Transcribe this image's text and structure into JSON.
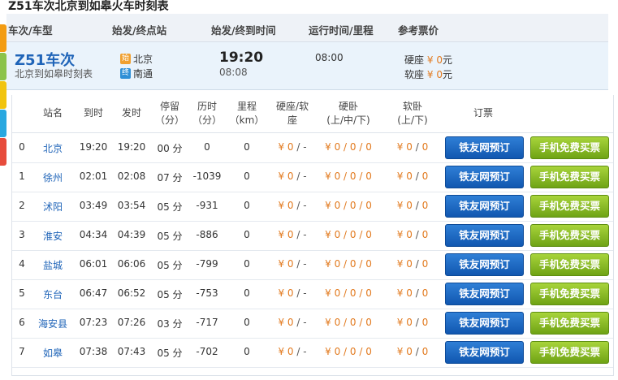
{
  "page_title": "Z51车次北京到如皋火车时刻表",
  "header": {
    "col_train": "车次/车型",
    "col_stations": "始发/终点站",
    "col_times": "始发/终到时间",
    "col_runtime": "运行时间/里程",
    "col_fare": "参考票价"
  },
  "summary": {
    "train_no": "Z51车次",
    "subtitle": "北京到如皋时刻表",
    "start_icon": "始",
    "start_station": "北京",
    "end_icon": "终",
    "end_station": "南通",
    "depart_time": "19:20",
    "arrive_time": "08:08",
    "run_time": "08:00",
    "fares": [
      {
        "label": "硬座",
        "currency": "¥",
        "value": "0",
        "unit": "元"
      },
      {
        "label": "软座",
        "currency": "¥",
        "value": "0",
        "unit": "元"
      }
    ]
  },
  "table": {
    "headers": {
      "station": "站名",
      "arrive": "到时",
      "depart": "发时",
      "stop_1": "停留",
      "stop_2": "（分）",
      "elapsed_1": "历时",
      "elapsed_2": "（分）",
      "mileage_1": "里程",
      "mileage_2": "（km）",
      "seat_1": "硬座/软",
      "seat_2": "座",
      "hard_sleeper_1": "硬卧",
      "hard_sleeper_2": "(上/中/下)",
      "soft_sleeper_1": "软卧",
      "soft_sleeper_2": "(上/下)",
      "booking": "订票"
    },
    "buttons": {
      "web": "铁友网预订",
      "mobile": "手机免费买票"
    },
    "rows": [
      {
        "idx": "0",
        "station": "北京",
        "arrive": "19:20",
        "depart": "19:20",
        "stop": "00 分",
        "elapsed": "0",
        "mileage": "0",
        "seat": [
          "¥",
          "0",
          "/ -"
        ],
        "hard": [
          "¥",
          "0",
          "/ 0 /",
          "0"
        ],
        "soft": [
          "¥",
          "0",
          "/",
          "0"
        ]
      },
      {
        "idx": "1",
        "station": "徐州",
        "arrive": "02:01",
        "depart": "02:08",
        "stop": "07 分",
        "elapsed": "-1039",
        "mileage": "0",
        "seat": [
          "¥",
          "0",
          "/ -"
        ],
        "hard": [
          "¥",
          "0",
          "/ 0 /",
          "0"
        ],
        "soft": [
          "¥",
          "0",
          "/",
          "0"
        ]
      },
      {
        "idx": "2",
        "station": "沭阳",
        "arrive": "03:49",
        "depart": "03:54",
        "stop": "05 分",
        "elapsed": "-931",
        "mileage": "0",
        "seat": [
          "¥",
          "0",
          "/ -"
        ],
        "hard": [
          "¥",
          "0",
          "/ 0 /",
          "0"
        ],
        "soft": [
          "¥",
          "0",
          "/",
          "0"
        ]
      },
      {
        "idx": "3",
        "station": "淮安",
        "arrive": "04:34",
        "depart": "04:39",
        "stop": "05 分",
        "elapsed": "-886",
        "mileage": "0",
        "seat": [
          "¥",
          "0",
          "/ -"
        ],
        "hard": [
          "¥",
          "0",
          "/ 0 /",
          "0"
        ],
        "soft": [
          "¥",
          "0",
          "/",
          "0"
        ]
      },
      {
        "idx": "4",
        "station": "盐城",
        "arrive": "06:01",
        "depart": "06:06",
        "stop": "05 分",
        "elapsed": "-799",
        "mileage": "0",
        "seat": [
          "¥",
          "0",
          "/ -"
        ],
        "hard": [
          "¥",
          "0",
          "/ 0 /",
          "0"
        ],
        "soft": [
          "¥",
          "0",
          "/",
          "0"
        ]
      },
      {
        "idx": "5",
        "station": "东台",
        "arrive": "06:47",
        "depart": "06:52",
        "stop": "05 分",
        "elapsed": "-753",
        "mileage": "0",
        "seat": [
          "¥",
          "0",
          "/ -"
        ],
        "hard": [
          "¥",
          "0",
          "/ 0 /",
          "0"
        ],
        "soft": [
          "¥",
          "0",
          "/",
          "0"
        ]
      },
      {
        "idx": "6",
        "station": "海安县",
        "arrive": "07:23",
        "depart": "07:26",
        "stop": "03 分",
        "elapsed": "-717",
        "mileage": "0",
        "seat": [
          "¥",
          "0",
          "/ -"
        ],
        "hard": [
          "¥",
          "0",
          "/ 0 /",
          "0"
        ],
        "soft": [
          "¥",
          "0",
          "/",
          "0"
        ]
      },
      {
        "idx": "7",
        "station": "如皋",
        "arrive": "07:38",
        "depart": "07:43",
        "stop": "05 分",
        "elapsed": "-702",
        "mileage": "0",
        "seat": [
          "¥",
          "0",
          "/ -"
        ],
        "hard": [
          "¥",
          "0",
          "/ 0 /",
          "0"
        ],
        "soft": [
          "¥",
          "0",
          "/",
          "0"
        ]
      }
    ]
  },
  "colors": {
    "accent_blue": "#1f64b8",
    "price_orange": "#e27a1f",
    "button_blue": "#1a66c2",
    "button_green": "#86b723",
    "left_tabs": [
      "#f39c12",
      "#8bc34a",
      "#f1c40f",
      "#29a8e0",
      "#e74c3c"
    ]
  }
}
